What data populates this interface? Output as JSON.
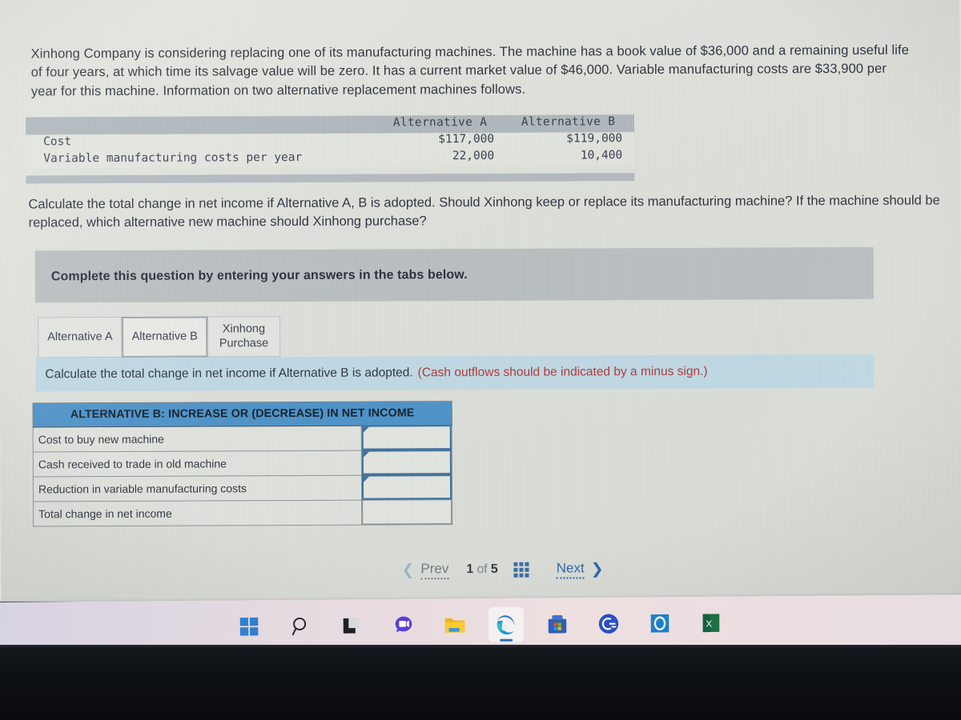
{
  "problem": {
    "paragraph": "Xinhong Company is considering replacing one of its manufacturing machines. The machine has a book value of $36,000 and a remaining useful life of four years, at which time its salvage value will be zero. It has a current market value of $46,000. Variable manufacturing costs are $33,900 per year for this machine. Information on two alternative replacement machines follows.",
    "question": "Calculate the total change in net income if Alternative A, B is adopted. Should Xinhong keep or replace its manufacturing machine? If the machine should be replaced, which alternative new machine should Xinhong purchase?"
  },
  "data_table": {
    "col_headers": [
      "Alternative A",
      "Alternative B"
    ],
    "rows": [
      {
        "label": "Cost",
        "alt_a": "$117,000",
        "alt_b": "$119,000"
      },
      {
        "label": "Variable manufacturing costs per year",
        "alt_a": "22,000",
        "alt_b": "10,400"
      }
    ]
  },
  "complete_banner": {
    "text": "Complete this question by entering your answers in the tabs below."
  },
  "tabs": [
    {
      "label": "Alternative A",
      "selected": false
    },
    {
      "label": "Alternative B",
      "selected": true
    },
    {
      "label": "Xinhong Purchase",
      "line1": "Xinhong",
      "line2": "Purchase",
      "selected": false
    }
  ],
  "instruction": {
    "main": "Calculate the total change in net income if Alternative B is adopted.",
    "note": "(Cash outflows should be indicated by a minus sign.)",
    "note_color": "#b03a3a"
  },
  "answer_table": {
    "header": "ALTERNATIVE B: INCREASE OR (DECREASE) IN NET INCOME",
    "header_color": "#4d92c8",
    "rows": [
      {
        "label": "Cost to buy new machine",
        "value": "",
        "input": true
      },
      {
        "label": "Cash received to trade in old machine",
        "value": "",
        "input": true
      },
      {
        "label": "Reduction in variable manufacturing costs",
        "value": "",
        "input": true
      },
      {
        "label": "Total change in net income",
        "value": "",
        "input": false
      }
    ]
  },
  "pager": {
    "prev_label": "Prev",
    "next_label": "Next",
    "current_page": "1",
    "of_label": "of",
    "total_pages": "5",
    "prev_enabled": false,
    "next_enabled": true,
    "grid_icon": "grid-menu-icon"
  },
  "taskbar": {
    "items": [
      {
        "name": "start-icon",
        "label": "Start",
        "active": false
      },
      {
        "name": "search-icon",
        "label": "Search",
        "active": false
      },
      {
        "name": "task-view-icon",
        "label": "Task View",
        "active": false
      },
      {
        "name": "chat-teams-icon",
        "label": "Chat",
        "active": false
      },
      {
        "name": "file-explorer-icon",
        "label": "File Explorer",
        "active": false
      },
      {
        "name": "microsoft-edge-icon",
        "label": "Microsoft Edge",
        "active": true
      },
      {
        "name": "microsoft-store-icon",
        "label": "Microsoft Store",
        "active": false
      },
      {
        "name": "bing-search-icon",
        "label": "Bing",
        "active": false
      },
      {
        "name": "outlook-icon",
        "label": "Outlook",
        "active": false
      },
      {
        "name": "excel-icon",
        "label": "Excel",
        "active": false
      }
    ]
  }
}
